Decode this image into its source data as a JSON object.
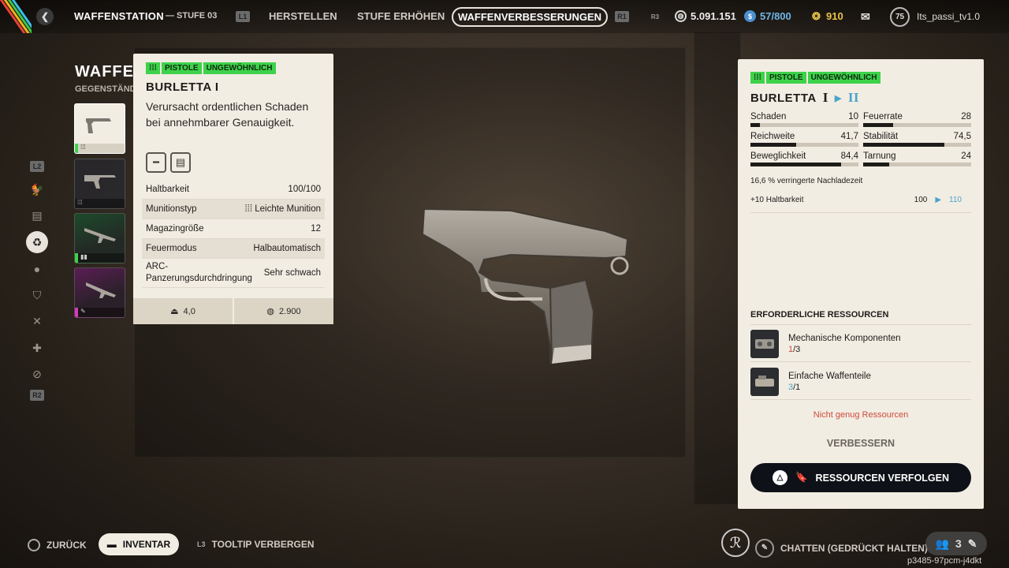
{
  "topbar": {
    "title": "WAFFENSTATION",
    "level": "— STUFE 03",
    "chip_l1": "L1",
    "chip_r1": "R1",
    "chip_r3": "R3",
    "tabs": [
      "HERSTELLEN",
      "STUFE ERHÖHEN"
    ],
    "active_tab": "WAFFENVERBESSERUNGEN",
    "currency_coins": "5.091.151",
    "currency_tokens": "57/800",
    "currency_seeds": "910",
    "player_level": "75",
    "username": "Its_passi_tv1.0"
  },
  "left": {
    "section_title": "WAFFE",
    "section_subtitle": "GEGENSTÄND",
    "rail_chip_top": "L2",
    "rail_chip_bottom": "R2",
    "rail_icons": [
      "chicken-icon",
      "bench-icon",
      "recycle-icon",
      "grenade-icon",
      "shield-icon",
      "tools-icon",
      "medkit-icon",
      "no-signal-icon"
    ]
  },
  "tooltip": {
    "tag_type": "PISTOLE",
    "tag_rarity": "UNGEWÖHNLICH",
    "name": "BURLETTA I",
    "description": "Verursacht ordentlichen Schaden bei annehmbarer Genauigkeit.",
    "rows": [
      {
        "label": "Haltbarkeit",
        "value": "100/100"
      },
      {
        "label": "Munitionstyp",
        "value": "Leichte Munition"
      },
      {
        "label": "Magazingröße",
        "value": "12"
      },
      {
        "label": "Feuermodus",
        "value": "Halbautomatisch"
      },
      {
        "label": "ARC-Panzerungsdurchdringung",
        "value": "Sehr schwach"
      }
    ],
    "weight": "4,0",
    "price": "2.900"
  },
  "panel": {
    "tag_type": "PISTOLE",
    "tag_rarity": "UNGEWÖHNLICH",
    "name": "BURLETTA",
    "tier_from": "I",
    "tier_to": "II",
    "stats": [
      {
        "label": "Schaden",
        "value": "10",
        "fill": 0.09
      },
      {
        "label": "Feuerrate",
        "value": "28",
        "fill": 0.28
      },
      {
        "label": "Reichweite",
        "value": "41,7",
        "fill": 0.42
      },
      {
        "label": "Stabilität",
        "value": "74,5",
        "fill": 0.75
      },
      {
        "label": "Beweglichkeit",
        "value": "84,4",
        "fill": 0.84
      },
      {
        "label": "Tarnung",
        "value": "24",
        "fill": 0.24
      }
    ],
    "note": "16,6 % verringerte Nachladezeit",
    "durability_label": "+10 Haltbarkeit",
    "durability_old": "100",
    "durability_new": "110",
    "required_title": "ERFORDERLICHE RESSOURCEN",
    "resources": [
      {
        "name": "Mechanische Komponenten",
        "have": "1",
        "need": "/3"
      },
      {
        "name": "Einfache Waffenteile",
        "have": "3",
        "need": "/1"
      }
    ],
    "warning": "Nicht genug Ressourcen",
    "improve_label": "VERBESSERN",
    "track_label": "RESSOURCEN VERFOLGEN"
  },
  "bottom": {
    "back": "ZURÜCK",
    "inventory": "INVENTAR",
    "l3_chip": "L3",
    "tooltip_hide": "TOOLTIP VERBERGEN",
    "chat": "CHATTEN (GEDRÜCKT HALTEN)",
    "party_count": "3",
    "session_id": "p3485-97pcm-j4dkt"
  }
}
